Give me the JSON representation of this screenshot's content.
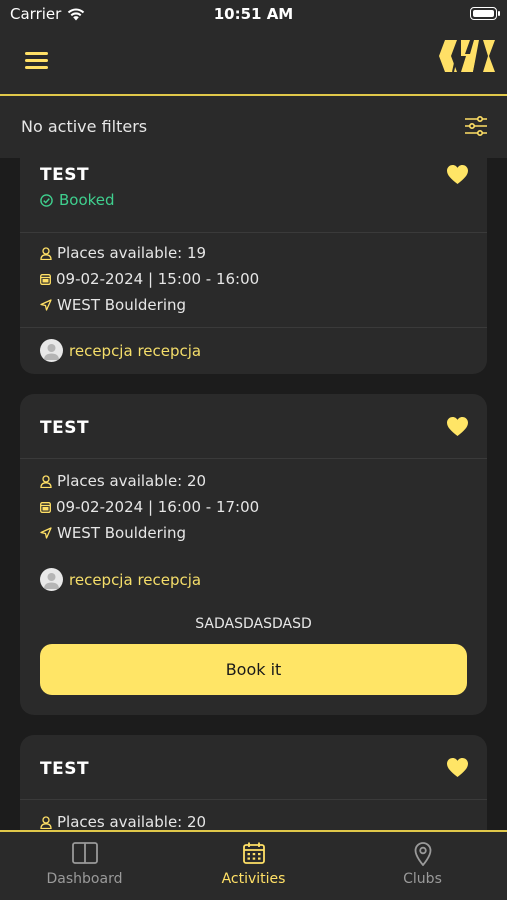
{
  "status_bar": {
    "carrier": "Carrier",
    "time": "10:51 AM"
  },
  "filter_bar": {
    "text": "No active filters"
  },
  "cards": [
    {
      "title": "TEST",
      "status": "Booked",
      "places": "Places available: 19",
      "datetime": "09-02-2024 | 15:00 - 16:00",
      "location": "WEST Bouldering",
      "trainer": "recepcja recepcja"
    },
    {
      "title": "TEST",
      "places": "Places available: 20",
      "datetime": "09-02-2024 | 16:00 - 17:00",
      "location": "WEST Bouldering",
      "trainer": "recepcja recepcja",
      "description": "SADASDASDASD",
      "button": "Book it"
    },
    {
      "title": "TEST",
      "places": "Places available: 20"
    }
  ],
  "tabs": [
    {
      "label": "Dashboard",
      "icon": "book-icon",
      "active": false
    },
    {
      "label": "Activities",
      "icon": "calendar-icon",
      "active": true
    },
    {
      "label": "Clubs",
      "icon": "map-pin-icon",
      "active": false
    }
  ],
  "colors": {
    "accent": "#ffe066",
    "booked": "#3fcf8e",
    "card": "#2a2a2a",
    "background": "#1c1c1c"
  }
}
